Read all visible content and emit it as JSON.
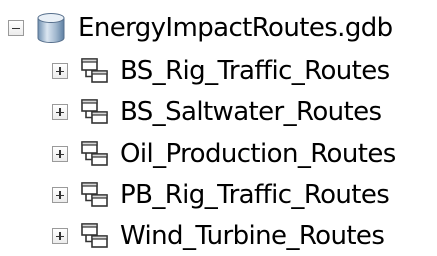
{
  "catalog_tree": {
    "geodatabase": {
      "name": "EnergyImpactRoutes.gdb",
      "expanded": true,
      "icon": "database-cylinder-icon"
    },
    "items": [
      {
        "label": "BS_Rig_Traffic_Routes",
        "icon": "route-dataset-icon",
        "expanded": false
      },
      {
        "label": "BS_Saltwater_Routes",
        "icon": "route-dataset-icon",
        "expanded": false
      },
      {
        "label": "Oil_Production_Routes",
        "icon": "route-dataset-icon",
        "expanded": false
      },
      {
        "label": "PB_Rig_Traffic_Routes",
        "icon": "route-dataset-icon",
        "expanded": false
      },
      {
        "label": "Wind_Turbine_Routes",
        "icon": "route-dataset-icon",
        "expanded": false
      }
    ]
  }
}
